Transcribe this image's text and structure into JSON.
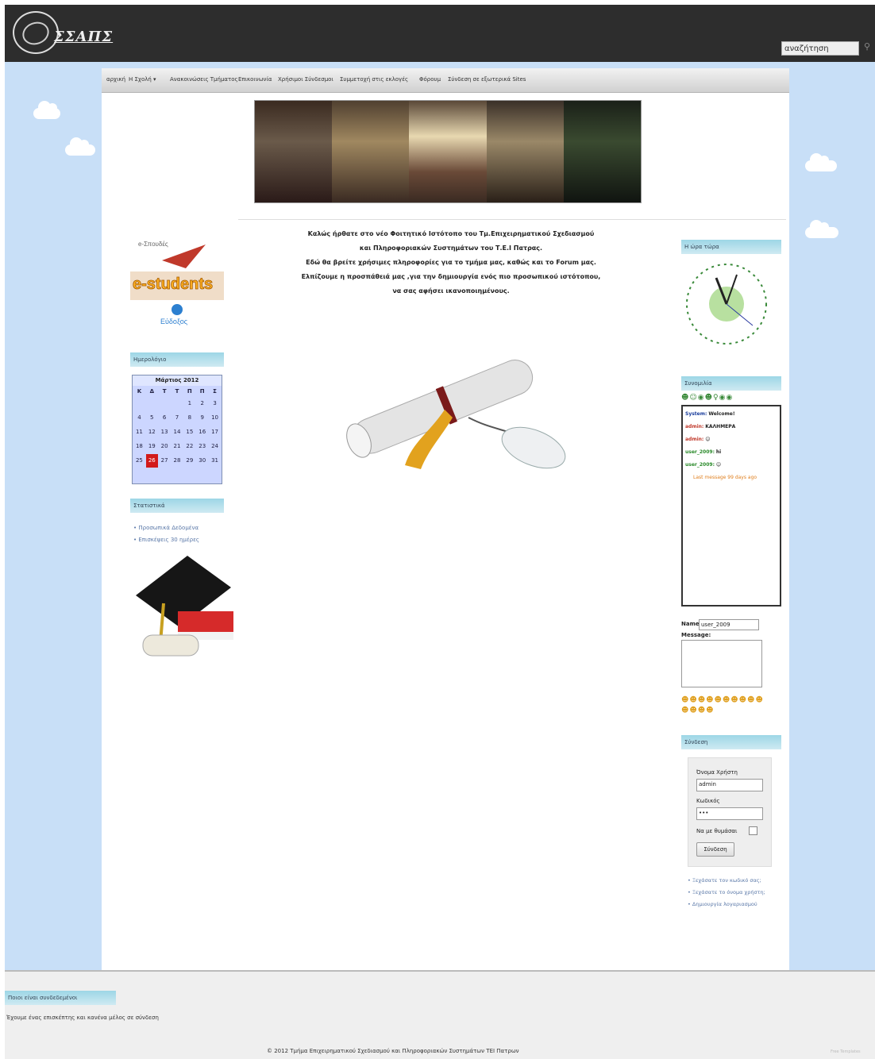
{
  "header": {
    "logo_text": "ΣΣΑΠΣ",
    "search_value": "αναζήτηση"
  },
  "nav": [
    "αρχική",
    "Η Σχολή ▾",
    "Ανακοινώσεις Τμήματος",
    "Επικοινωνία",
    "Χρήσιμοι Σύνδεσμοι",
    "Συμμετοχή στις εκλογές",
    "Φόρουμ",
    "Σύνδεση σε εξωτερικά Sites"
  ],
  "welcome": [
    "Καλώς ήρθατε στο νέο Φοιτητικό Ιστότοπο του Τμ.Επιχειρηματικού Σχεδιασμού",
    "και Πληροφοριακών Συστημάτων του Τ.Ε.Ι Πατρας.",
    "Εδώ θα βρείτε χρήσιμες πληροφορίες για το τμήμα μας, καθώς και το Forum μας.",
    "Ελπίζουμε η προσπάθειά μας ,για την δημιουργία ενός πιο προσωπικού ιστότοπου,",
    "να σας αφήσει ικανοποιημένους."
  ],
  "left": {
    "estudents_logo": "e-students",
    "estudents_top": "e-Σπουδές",
    "estudents_bottom": "Εύδοξος",
    "calendar_title": "Ημερολόγιο",
    "calendar_month": "Μάρτιος 2012",
    "calendar_head": [
      "Κ",
      "Δ",
      "Τ",
      "Τ",
      "Π",
      "Π",
      "Σ"
    ],
    "calendar_days": [
      "",
      "",
      "",
      "",
      "1",
      "2",
      "3",
      "4",
      "5",
      "6",
      "7",
      "8",
      "9",
      "10",
      "11",
      "12",
      "13",
      "14",
      "15",
      "16",
      "17",
      "18",
      "19",
      "20",
      "21",
      "22",
      "23",
      "24",
      "25",
      "26",
      "27",
      "28",
      "29",
      "30",
      "31"
    ],
    "calendar_today": "26",
    "stats_title": "Στατιστικά",
    "stats_links": [
      "Προσωπικά Δεδομένα",
      "Επισκέψεις 30 ημέρες"
    ]
  },
  "right": {
    "clock_title": "Η ώρα τώρα",
    "shout_title": "Συνομιλία",
    "shout_lines": [
      {
        "user": "System:",
        "text": "Welcome!",
        "color": "#1a3d9c"
      },
      {
        "user": "admin:",
        "text": "ΚΑΛΗΜΕΡΑ",
        "color": "#c0392b"
      },
      {
        "user": "admin:",
        "text": "☺",
        "color": "#c0392b"
      },
      {
        "user": "user_2009:",
        "text": "hi",
        "color": "#2a8a2a"
      },
      {
        "user": "user_2009:",
        "text": "☺",
        "color": "#2a8a2a"
      }
    ],
    "shout_last": "Last message 99 days ago",
    "name_label": "Name:",
    "name_value": "user_2009",
    "message_label": "Message:",
    "login_title": "Σύνδεση",
    "username_label": "Όνομα Χρήστη",
    "username_value": "admin",
    "password_label": "Κωδικός",
    "password_value": "•••",
    "remember_label": "Να με θυμάσαι",
    "login_button": "Σύνδεση",
    "login_links": [
      "Ξεχάσατε τον κωδικό σας;",
      "Ξεχάσατε το όνομα χρήστη;",
      "Δημιουργία λογαριασμού"
    ]
  },
  "footer": {
    "online_title": "Ποιοι είναι συνδεδεμένοι",
    "online_text": "Έχουμε ένας επισκέπτης και κανένα μέλος σε σύνδεση",
    "copyright": "© 2012 Τμήμα Επιχειρηματικού Σχεδιασμού και Πληροφοριακών Συστημάτων ΤΕΙ Πατρων",
    "corner": "Free Templates"
  }
}
